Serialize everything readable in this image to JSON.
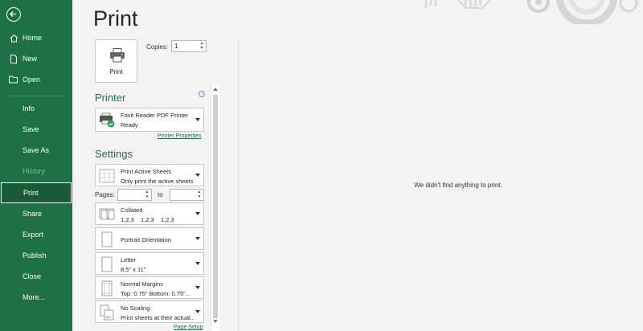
{
  "sidebar": {
    "items": [
      {
        "label": "Home",
        "icon": "home-icon"
      },
      {
        "label": "New",
        "icon": "new-document-icon"
      },
      {
        "label": "Open",
        "icon": "folder-open-icon"
      },
      {
        "label": "Info"
      },
      {
        "label": "Save"
      },
      {
        "label": "Save As"
      },
      {
        "label": "History"
      },
      {
        "label": "Print"
      },
      {
        "label": "Share"
      },
      {
        "label": "Export"
      },
      {
        "label": "Publish"
      },
      {
        "label": "Close"
      },
      {
        "label": "More..."
      }
    ],
    "selected": "Print",
    "disabled": "History"
  },
  "page": {
    "title": "Print"
  },
  "print_button": {
    "label": "Print"
  },
  "copies": {
    "label": "Copies:",
    "value": "1"
  },
  "printer": {
    "heading": "Printer",
    "name": "Foxit Reader PDF Printer",
    "status": "Ready",
    "properties_link": "Printer Properties"
  },
  "settings": {
    "heading": "Settings",
    "print_what": {
      "line1": "Print Active Sheets",
      "line2": "Only print the active sheets"
    },
    "pages": {
      "label": "Pages:",
      "to_label": "to",
      "from": "",
      "to": ""
    },
    "collation": {
      "line1": "Collated",
      "line2": "1,2,3    1,2,3    1,2,3"
    },
    "orientation": {
      "line1": "Portrait Orientation"
    },
    "paper": {
      "line1": "Letter",
      "line2": "8.5\" x 11\""
    },
    "margins": {
      "line1": "Normal Margins",
      "line2": "Top: 0.75\" Bottom: 0.75\"..."
    },
    "scaling": {
      "line1": "No Scaling",
      "line2": "Print sheets at their actual..."
    },
    "page_setup_link": "Page Setup"
  },
  "preview": {
    "message": "We didn't find anything to print."
  },
  "colors": {
    "accent": "#1e7145",
    "selected_bg": "#185c37"
  }
}
